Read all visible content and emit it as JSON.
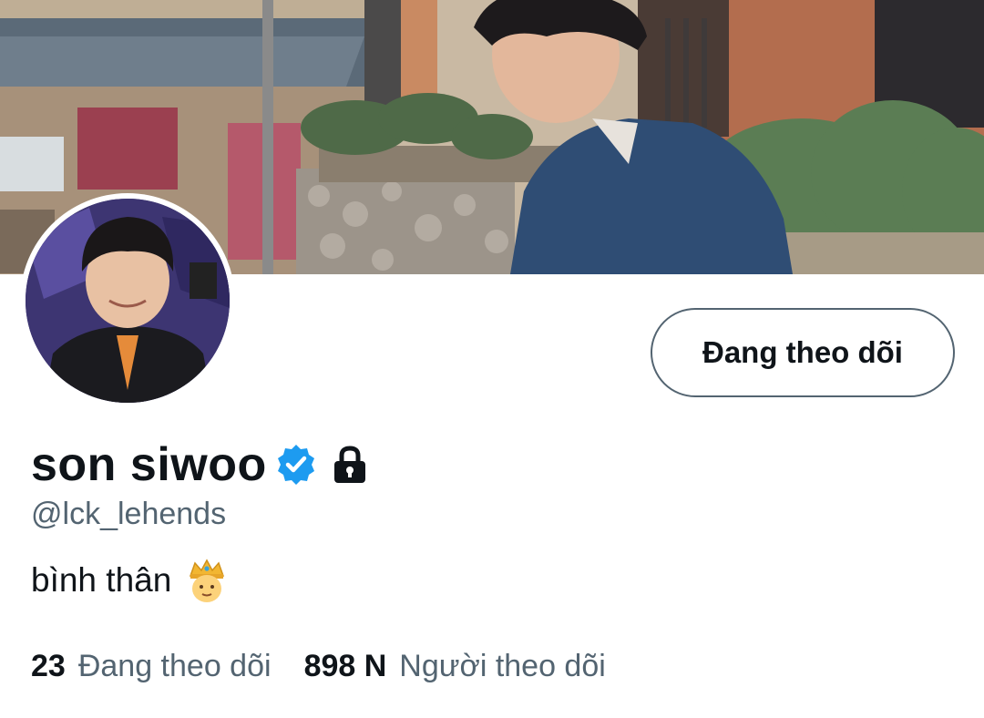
{
  "profile": {
    "display_name": "son siwoo",
    "handle": "@lck_lehends",
    "bio": "bình thân",
    "verified_icon": "verified-badge-icon",
    "protected_icon": "lock-icon",
    "bio_emoji_icon": "crowned-person-emoji"
  },
  "actions": {
    "follow_button_label": "Đang theo dõi"
  },
  "stats": {
    "following_count": "23",
    "following_label": "Đang theo dõi",
    "followers_count": "898 N",
    "followers_label": "Người theo dõi"
  },
  "colors": {
    "primary_text": "#0f1419",
    "secondary_text": "#536471",
    "verified_blue": "#1d9bf0",
    "border": "#536471"
  }
}
